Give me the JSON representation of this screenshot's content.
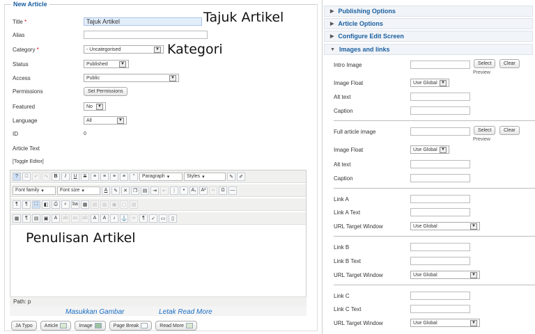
{
  "form": {
    "legend": "New Article",
    "title_label": "Title",
    "title_value": "Tajuk Artikel",
    "alias_label": "Alias",
    "category_label": "Category",
    "category_value": "- Uncategorised",
    "status_label": "Status",
    "status_value": "Published",
    "access_label": "Access",
    "access_value": "Public",
    "permissions_label": "Permissions",
    "permissions_button": "Set Permissions",
    "featured_label": "Featured",
    "featured_value": "No",
    "language_label": "Language",
    "language_value": "All",
    "id_label": "ID",
    "id_value": "0",
    "article_text_label": "Article Text",
    "toggle_editor": "[Toggle Editor]"
  },
  "annotations": {
    "title": "Tajuk Artikel",
    "category": "Kategori",
    "content": "Penulisan Artikel",
    "insert_image": "Masukkan Gambar",
    "read_more": "Letak Read More"
  },
  "editor": {
    "paragraph": "Paragraph",
    "styles": "Styles",
    "font_family": "Font family",
    "font_size": "Font size",
    "path": "Path: p"
  },
  "extra_buttons": [
    "JA Typo",
    "Article",
    "Image",
    "Page Break",
    "Read More"
  ],
  "accordion": {
    "publishing": "Publishing Options",
    "article": "Article Options",
    "configure": "Configure Edit Screen",
    "images": "Images and links"
  },
  "images": {
    "intro_image": "Intro Image",
    "image_float": "Image Float",
    "float_value": "Use Global",
    "alt_text": "Alt text",
    "caption": "Caption",
    "full_image": "Full article image",
    "select": "Select",
    "clear": "Clear",
    "preview": "Preview",
    "link_a": "Link A",
    "link_a_text": "Link A Text",
    "url_target": "URL Target Window",
    "target_value": "Use Global",
    "link_b": "Link B",
    "link_b_text": "Link B Text",
    "link_c": "Link C",
    "link_c_text": "Link C Text"
  }
}
